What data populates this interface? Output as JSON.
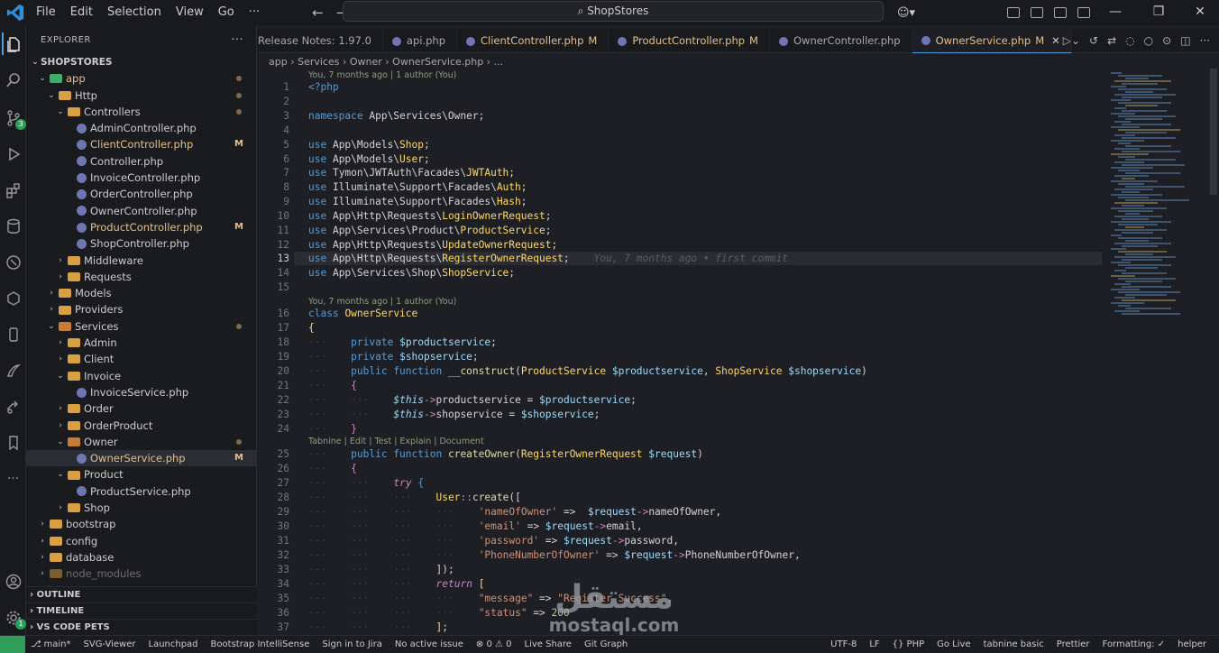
{
  "titlebar": {
    "menus": [
      "File",
      "Edit",
      "Selection",
      "View",
      "Go",
      "···"
    ],
    "search": "ShopStores"
  },
  "sidebar": {
    "title": "EXPLORER",
    "root": "SHOPSTORES",
    "tree": [
      {
        "name": "app",
        "depth": 0,
        "type": "folder",
        "open": true,
        "dot": true,
        "color": "green"
      },
      {
        "name": "Http",
        "depth": 1,
        "type": "folder",
        "open": true,
        "dot": true
      },
      {
        "name": "Controllers",
        "depth": 2,
        "type": "folder",
        "open": true,
        "dot": true
      },
      {
        "name": "AdminController.php",
        "depth": 3,
        "type": "php"
      },
      {
        "name": "ClientController.php",
        "depth": 3,
        "type": "php",
        "mod": "M"
      },
      {
        "name": "Controller.php",
        "depth": 3,
        "type": "php"
      },
      {
        "name": "InvoiceController.php",
        "depth": 3,
        "type": "php"
      },
      {
        "name": "OrderController.php",
        "depth": 3,
        "type": "php"
      },
      {
        "name": "OwnerController.php",
        "depth": 3,
        "type": "php"
      },
      {
        "name": "ProductController.php",
        "depth": 3,
        "type": "php",
        "mod": "M"
      },
      {
        "name": "ShopController.php",
        "depth": 3,
        "type": "php"
      },
      {
        "name": "Middleware",
        "depth": 2,
        "type": "folder"
      },
      {
        "name": "Requests",
        "depth": 2,
        "type": "folder"
      },
      {
        "name": "Models",
        "depth": 1,
        "type": "folder"
      },
      {
        "name": "Providers",
        "depth": 1,
        "type": "folder"
      },
      {
        "name": "Services",
        "depth": 1,
        "type": "folder",
        "open": true,
        "dot": true,
        "color": "orange"
      },
      {
        "name": "Admin",
        "depth": 2,
        "type": "folder"
      },
      {
        "name": "Client",
        "depth": 2,
        "type": "folder"
      },
      {
        "name": "Invoice",
        "depth": 2,
        "type": "folder",
        "open": true
      },
      {
        "name": "InvoiceService.php",
        "depth": 3,
        "type": "php"
      },
      {
        "name": "Order",
        "depth": 2,
        "type": "folder"
      },
      {
        "name": "OrderProduct",
        "depth": 2,
        "type": "folder"
      },
      {
        "name": "Owner",
        "depth": 2,
        "type": "folder",
        "open": true,
        "dot": true,
        "color": "orange"
      },
      {
        "name": "OwnerService.php",
        "depth": 3,
        "type": "php",
        "mod": "M",
        "selected": true
      },
      {
        "name": "Product",
        "depth": 2,
        "type": "folder",
        "open": true
      },
      {
        "name": "ProductService.php",
        "depth": 3,
        "type": "php"
      },
      {
        "name": "Shop",
        "depth": 2,
        "type": "folder"
      },
      {
        "name": "bootstrap",
        "depth": 0,
        "type": "folder"
      },
      {
        "name": "config",
        "depth": 0,
        "type": "folder"
      },
      {
        "name": "database",
        "depth": 0,
        "type": "folder"
      },
      {
        "name": "node_modules",
        "depth": 0,
        "type": "folder",
        "dim": true
      }
    ],
    "sections": [
      "OUTLINE",
      "TIMELINE",
      "VS CODE PETS"
    ]
  },
  "tabs": [
    {
      "label": "Release Notes: 1.97.0"
    },
    {
      "label": "api.php"
    },
    {
      "label": "ClientController.php",
      "mod": "M"
    },
    {
      "label": "ProductController.php",
      "mod": "M"
    },
    {
      "label": "OwnerController.php"
    },
    {
      "label": "OwnerService.php",
      "mod": "M",
      "active": true
    }
  ],
  "breadcrumb": "app › Services › Owner › OwnerService.php › ...",
  "codelens": {
    "l1": "You, 7 months ago | 1 author (You)",
    "l16": "You, 7 months ago | 1 author (You)",
    "l25": "Tabnine | Edit | Test | Explain | Document"
  },
  "blame": "You, 7 months ago • first commit",
  "status": {
    "branch": "main*",
    "items": [
      "SVG-Viewer",
      "Launchpad",
      "Bootstrap IntelliSense",
      "Sign in to Jira",
      "No active issue",
      "⊗ 0 ⚠ 0",
      "Live Share",
      "Git Graph"
    ],
    "right": [
      "UTF-8",
      "LF",
      "{} PHP",
      "Go Live",
      "tabnine basic",
      "Prettier",
      "Formatting: ✓",
      "helper"
    ]
  },
  "badges": {
    "scm": "3",
    "account": "1"
  },
  "watermark": {
    "arabic": "مستقل",
    "latin": "mostaql.com"
  }
}
